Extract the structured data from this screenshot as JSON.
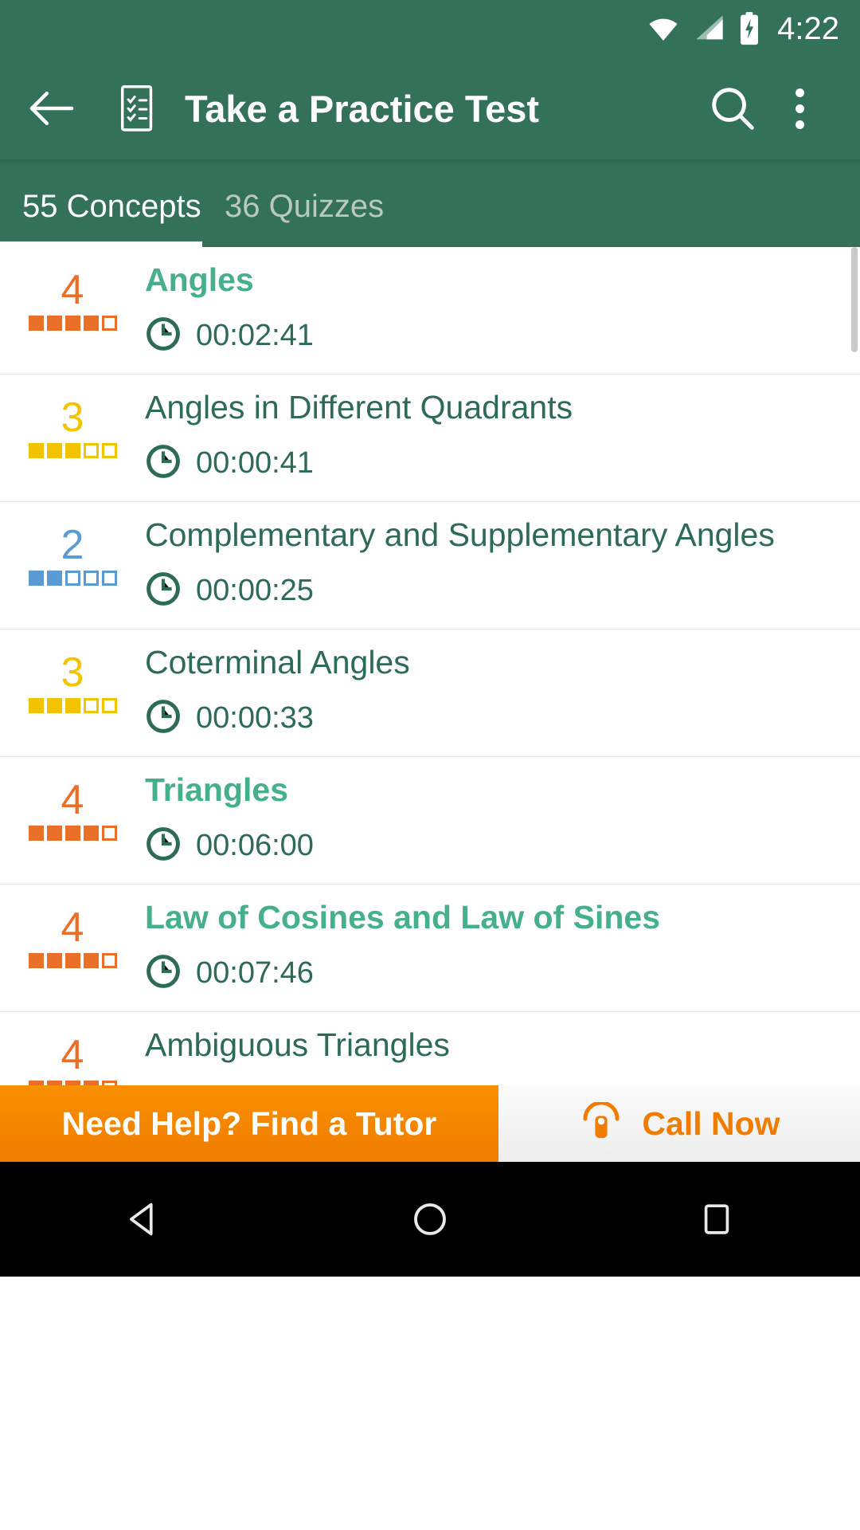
{
  "status_bar": {
    "time": "4:22",
    "icons": [
      "wifi-icon",
      "cellular-signal-icon",
      "battery-charging-icon"
    ]
  },
  "app_bar": {
    "back_label": "back-arrow",
    "doc_icon": "practice-test-document-icon",
    "title": "Take a Practice Test",
    "search_label": "search-icon",
    "overflow_label": "more-options-icon"
  },
  "tabs": [
    {
      "label": "55 Concepts",
      "active": true
    },
    {
      "label": "36 Quizzes",
      "active": false
    }
  ],
  "colors": {
    "primary_green": "#337158",
    "accent_green": "#45b08a",
    "text_green": "#2e6b54",
    "orange": "#ea7029",
    "yellow": "#f2c300",
    "blue": "#5b9bd5",
    "banner_orange": "#f07c00"
  },
  "list": [
    {
      "score": "4",
      "filled": 4,
      "total": 5,
      "color": "#ea7029",
      "title": "Angles",
      "highlighted": true,
      "time": "00:02:41"
    },
    {
      "score": "3",
      "filled": 3,
      "total": 5,
      "color": "#f2c300",
      "title": "Angles in Different Quadrants",
      "highlighted": false,
      "time": "00:00:41"
    },
    {
      "score": "2",
      "filled": 2,
      "total": 5,
      "color": "#5b9bd5",
      "title": "Complementary and Supplementary Angles",
      "highlighted": false,
      "time": "00:00:25"
    },
    {
      "score": "3",
      "filled": 3,
      "total": 5,
      "color": "#f2c300",
      "title": "Coterminal Angles",
      "highlighted": false,
      "time": "00:00:33"
    },
    {
      "score": "4",
      "filled": 4,
      "total": 5,
      "color": "#ea7029",
      "title": "Triangles",
      "highlighted": true,
      "time": "00:06:00"
    },
    {
      "score": "4",
      "filled": 4,
      "total": 5,
      "color": "#ea7029",
      "title": "Law of Cosines and Law of Sines",
      "highlighted": true,
      "time": "00:07:46"
    },
    {
      "score": "4",
      "filled": 4,
      "total": 5,
      "color": "#ea7029",
      "title": "Ambiguous Triangles",
      "highlighted": false,
      "time": ""
    }
  ],
  "banner": {
    "main_text": "Need Help? Find a Tutor",
    "call_icon": "telephone-icon",
    "call_text": "Call Now"
  },
  "nav_bar": {
    "back": "nav-back-icon",
    "home": "nav-home-icon",
    "recents": "nav-recents-icon"
  }
}
